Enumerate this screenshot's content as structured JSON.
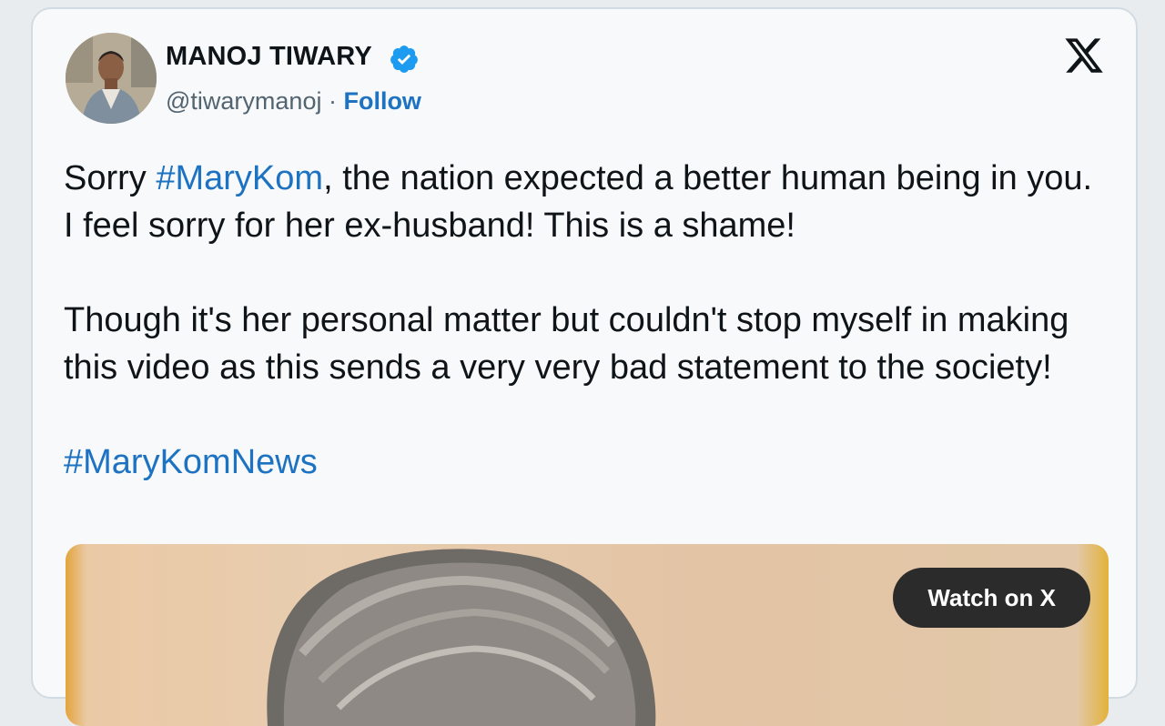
{
  "author": {
    "name": "MANOJ TIWARY",
    "handle": "@tiwarymanoj",
    "separator": " · ",
    "follow_label": "Follow",
    "verified": true
  },
  "platform": {
    "logo": "x-logo-icon"
  },
  "tweet": {
    "p1_prefix": "Sorry ",
    "p1_hashtag": "#MaryKom",
    "p1_rest": ", the nation expected a better human being in you. I feel sorry for her ex-husband! This is a shame!",
    "p2": "Though it's her personal matter but couldn't stop myself in making this video as this sends a very very bad statement to the society!",
    "hashtag2": "#MaryKomNews"
  },
  "media": {
    "watch_label": "Watch on X"
  },
  "colors": {
    "link": "#1d72c2",
    "verified": "#1d9bf0",
    "text": "#0f1419",
    "muted": "#536471"
  }
}
